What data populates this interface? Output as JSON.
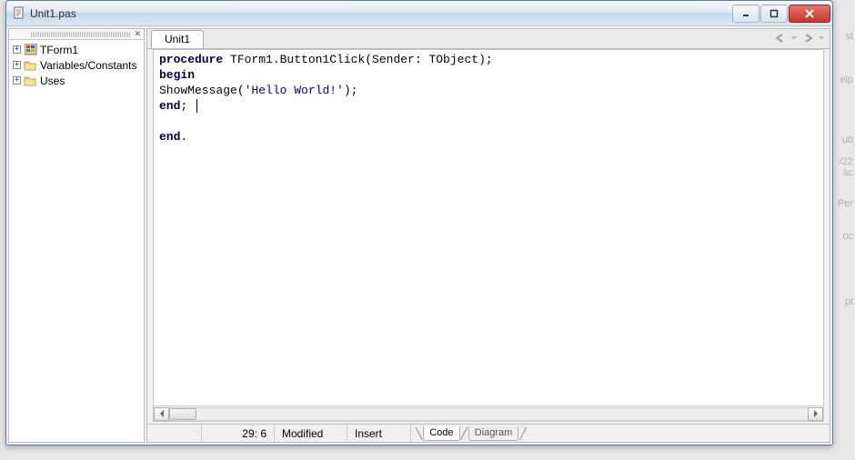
{
  "window": {
    "title": "Unit1.pas"
  },
  "tree": {
    "items": [
      {
        "label": "TForm1",
        "icon": "form-icon"
      },
      {
        "label": "Variables/Constants",
        "icon": "folder-icon"
      },
      {
        "label": "Uses",
        "icon": "folder-icon"
      }
    ]
  },
  "tabs": {
    "active": "Unit1"
  },
  "code": {
    "line1_kw": "procedure",
    "line1_rest": " TForm1.Button1Click(Sender: TObject);",
    "line2": "begin",
    "line3a": "ShowMessage(",
    "line3_str": "'Hello World!'",
    "line3b": ");",
    "line4_kw": "end",
    "line4_rest": "; ",
    "blank": "",
    "line6_kw": "end",
    "line6_rest": "."
  },
  "status": {
    "pos": "29:  6",
    "modified": "Modified",
    "mode": "Insert",
    "tab_code": "Code",
    "tab_diagram": "Diagram"
  },
  "bg": {
    "t1": "st",
    "t2": "elp",
    "t3": "ub",
    "t4": "/22",
    "t5": "ac",
    "t6": "Per",
    "t7": "oc",
    "t8": "pt"
  }
}
